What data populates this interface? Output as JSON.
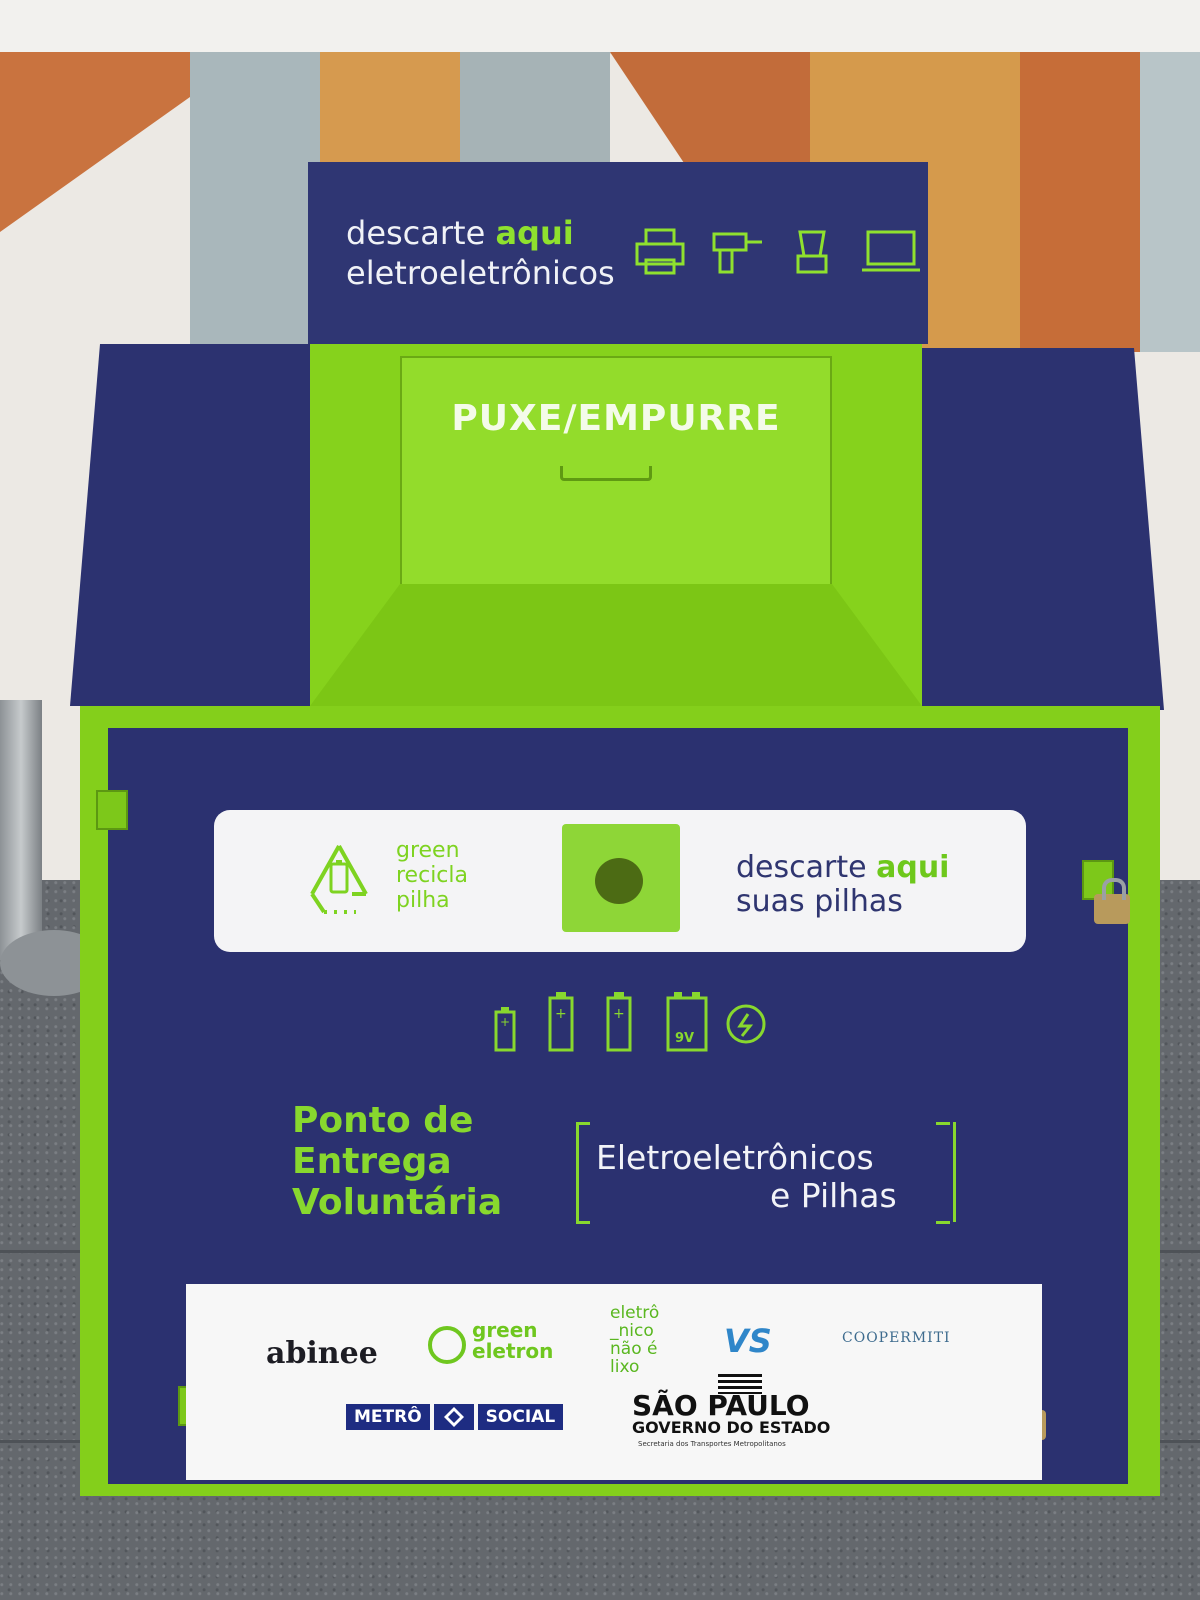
{
  "top_sign": {
    "line1_prefix": "descarte ",
    "line1_emphasis": "aqui",
    "line2": "eletroeletrônicos",
    "icons": [
      "printer-icon",
      "drill-icon",
      "blender-icon",
      "laptop-icon"
    ]
  },
  "chute": {
    "label": "PUXE/EMPURRE"
  },
  "battery_pill": {
    "brand_line1": "green",
    "brand_line2": "recicla",
    "brand_line3": "pilha",
    "right_prefix": "descarte ",
    "right_emphasis": "aqui",
    "right_line2": "suas pilhas"
  },
  "battery_icons": {
    "items": [
      "aa-battery-icon",
      "c-battery-icon",
      "c-battery-icon",
      "9v-battery-icon",
      "button-cell-icon"
    ],
    "nine_volt_label": "9V"
  },
  "main": {
    "pev_line1": "Ponto de",
    "pev_line2": "Entrega",
    "pev_line3": "Voluntária",
    "category_line1": "Eletroeletrônicos",
    "category_line2": "e Pilhas"
  },
  "sponsors": {
    "abinee": "abinee",
    "green_eletron_1": "green",
    "green_eletron_2": "eletron",
    "eletronico_1": "eletrô",
    "eletronico_2": "_nico",
    "eletronico_3": "não é",
    "eletronico_4": "lixo",
    "vs": "VS",
    "coopermiti": "COOPERMITI",
    "metro_1": "METRÔ",
    "metro_2": "SOCIAL",
    "sp_1": "SÃO PAULO",
    "sp_2": "GOVERNO DO ESTADO",
    "sp_3": "Secretaria dos Transportes Metropolitanos"
  },
  "colors": {
    "navy": "#2b3170",
    "lime": "#84cf1b",
    "accent_text": "#88d82e"
  }
}
